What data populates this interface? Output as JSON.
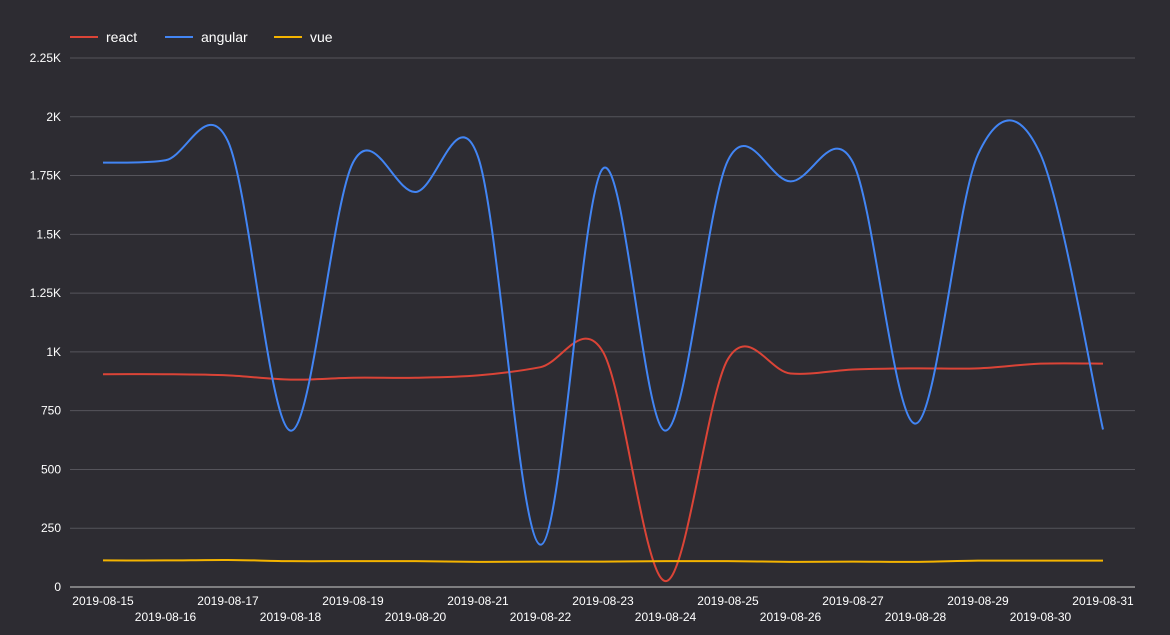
{
  "chart_data": {
    "type": "line",
    "title": "",
    "xlabel": "",
    "ylabel": "",
    "x": [
      "2019-08-15",
      "2019-08-16",
      "2019-08-17",
      "2019-08-18",
      "2019-08-19",
      "2019-08-20",
      "2019-08-21",
      "2019-08-22",
      "2019-08-23",
      "2019-08-24",
      "2019-08-25",
      "2019-08-26",
      "2019-08-27",
      "2019-08-28",
      "2019-08-29",
      "2019-08-30",
      "2019-08-31"
    ],
    "ylim": [
      0,
      2250
    ],
    "y_ticks": [
      0,
      250,
      500,
      750,
      1000,
      1250,
      1500,
      1750,
      2000,
      2250
    ],
    "y_tick_labels": [
      "0",
      "250",
      "500",
      "750",
      "1K",
      "1.25K",
      "1.5K",
      "1.75K",
      "2K",
      "2.25K"
    ],
    "grid": true,
    "legend_position": "top-left",
    "series": [
      {
        "name": "react",
        "color": "#db4437",
        "values": [
          905,
          905,
          900,
          882,
          890,
          890,
          900,
          935,
          1000,
          25,
          970,
          908,
          925,
          930,
          930,
          950,
          950
        ]
      },
      {
        "name": "angular",
        "color": "#4285f4",
        "values": [
          1805,
          1815,
          1895,
          665,
          1805,
          1680,
          1830,
          180,
          1780,
          665,
          1815,
          1725,
          1805,
          695,
          1840,
          1840,
          670
        ]
      },
      {
        "name": "vue",
        "color": "#f4b400",
        "values": [
          113,
          113,
          115,
          110,
          110,
          110,
          107,
          108,
          108,
          110,
          110,
          107,
          108,
          107,
          112,
          112,
          112
        ]
      }
    ]
  }
}
